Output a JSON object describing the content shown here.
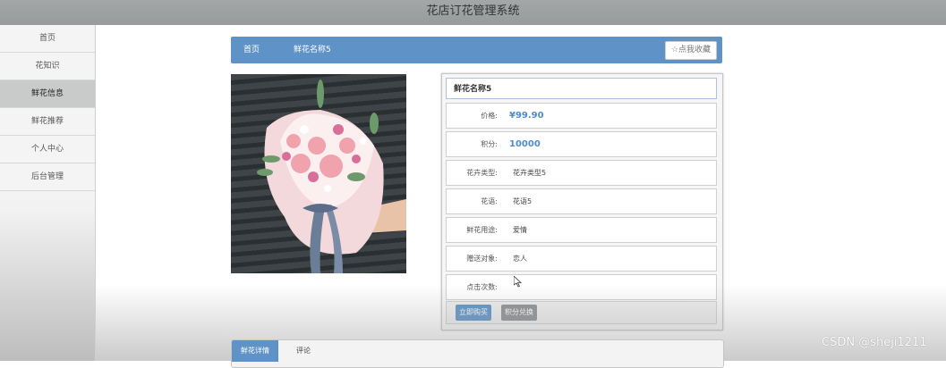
{
  "header": {
    "title": "花店订花管理系统"
  },
  "sidebar": {
    "items": [
      {
        "label": "首页",
        "active": false
      },
      {
        "label": "花知识",
        "active": false
      },
      {
        "label": "鲜花信息",
        "active": true
      },
      {
        "label": "鲜花推荐",
        "active": false
      },
      {
        "label": "个人中心",
        "active": false
      },
      {
        "label": "后台管理",
        "active": false
      }
    ]
  },
  "breadcrumb": {
    "home": "首页",
    "current": "鲜花名称5"
  },
  "favorite_button": "☆点我收藏",
  "product": {
    "title": "鲜花名称5",
    "fields": [
      {
        "label": "价格:",
        "value": "¥99.90"
      },
      {
        "label": "积分:",
        "value": "10000"
      },
      {
        "label": "花卉类型:",
        "value": "花卉类型5"
      },
      {
        "label": "花语:",
        "value": "花语5"
      },
      {
        "label": "鲜花用途:",
        "value": "爱情"
      },
      {
        "label": "赠送对象:",
        "value": "恋人"
      },
      {
        "label": "点击次数:",
        "value": ""
      }
    ],
    "buy_button": "立即购买",
    "points_button": "积分兑换"
  },
  "tabs": [
    {
      "label": "鲜花详情",
      "active": true
    },
    {
      "label": "评论",
      "active": false
    }
  ],
  "watermark": "CSDN @sheji1211",
  "colors": {
    "accent": "#5f93c7",
    "price": "#4f8cc9"
  }
}
